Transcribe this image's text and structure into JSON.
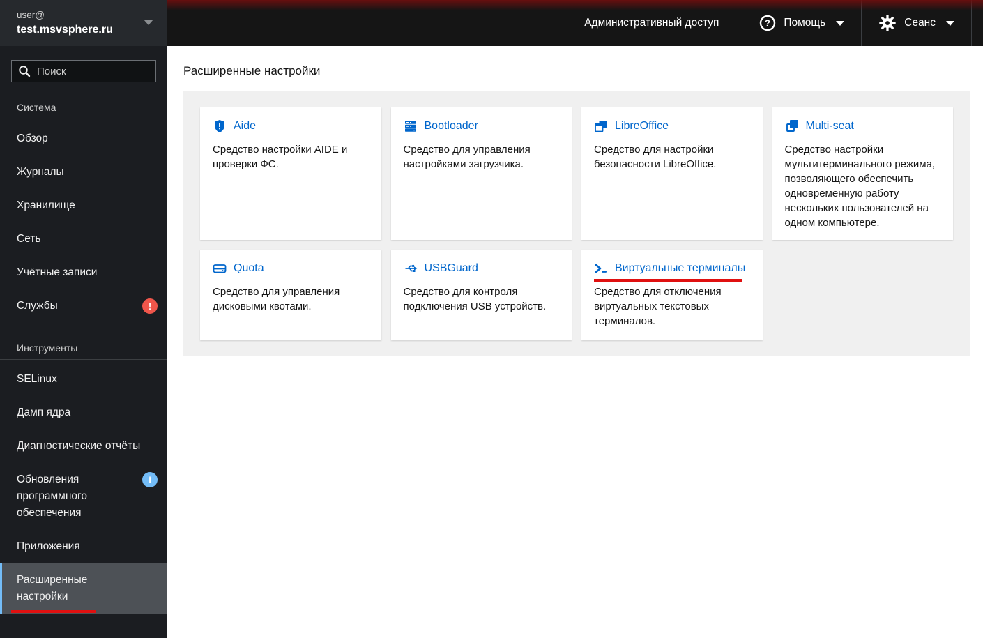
{
  "masthead": {
    "admin_access_label": "Административный доступ",
    "help": {
      "label": "Помощь",
      "icon": "question-circle-icon"
    },
    "session": {
      "label": "Сеанс",
      "icon": "gear-icon"
    }
  },
  "sidebar": {
    "username": "user@",
    "hostname": "test.msvsphere.ru",
    "search": {
      "placeholder": "Поиск"
    },
    "sections": [
      {
        "title": "Система",
        "items": [
          {
            "label": "Обзор"
          },
          {
            "label": "Журналы"
          },
          {
            "label": "Хранилище"
          },
          {
            "label": "Сеть"
          },
          {
            "label": "Учётные записи"
          },
          {
            "label": "Службы",
            "badge": "!"
          }
        ]
      },
      {
        "title": "Инструменты",
        "items": [
          {
            "label": "SELinux"
          },
          {
            "label": "Дамп ядра"
          },
          {
            "label": "Диагностические отчёты"
          },
          {
            "label": "Обновления программного обеспечения",
            "badge": "i"
          },
          {
            "label": "Приложения"
          },
          {
            "label": "Расширенные настройки",
            "active": true
          }
        ]
      }
    ]
  },
  "main": {
    "page_title": "Расширенные настройки",
    "cards": [
      {
        "title": "Aide",
        "description": "Средство настройки AIDE и проверки ФС.",
        "icon": "shield-exclamation-icon"
      },
      {
        "title": "Bootloader",
        "description": "Средство для управления настройками загрузчика.",
        "icon": "server-icon"
      },
      {
        "title": "LibreOffice",
        "description": "Средство для настройки безопасности LibreOffice.",
        "icon": "window-restore-icon"
      },
      {
        "title": "Multi-seat",
        "description": "Средство настройки мультитерминального режима, позволяющего обеспечить одновременную работу нескольких пользователей на одном компьютере.",
        "icon": "clone-icon"
      },
      {
        "title": "Quota",
        "description": "Средство для управления дисковыми квотами.",
        "icon": "hdd-icon"
      },
      {
        "title": "USBGuard",
        "description": "Средство для контроля подключения USB устройств.",
        "icon": "usb-icon"
      },
      {
        "title": "Виртуальные терминалы",
        "description": "Средство для отключения виртуальных текстовых терминалов.",
        "icon": "terminal-icon",
        "underlined": true
      }
    ]
  },
  "colors": {
    "link_blue": "#0066cc",
    "danger_badge": "#f0564b",
    "info_badge": "#73bcf7",
    "active_nav_border": "#73bcf7",
    "red_underline": "#e01010",
    "masthead_bg": "#151515",
    "masthead_red_tint": "#700e0e",
    "sidebar_bg": "#1b1d21",
    "sidebar_header_bg": "#26292d",
    "active_nav_bg": "#4d5156",
    "panel_bg": "#f0f0f0"
  }
}
